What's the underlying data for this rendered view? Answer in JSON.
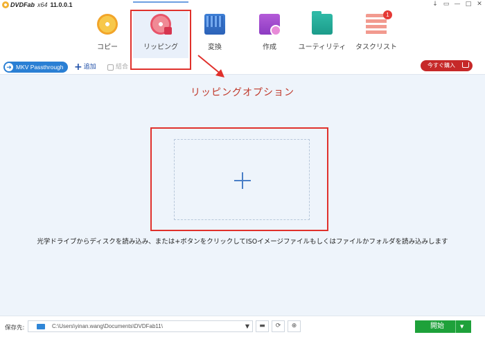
{
  "titlebar": {
    "brand": "DVDFab",
    "arch": "x64",
    "version": "11.0.0.1"
  },
  "window_controls": [
    "↓",
    "▭",
    "—",
    "□",
    "✕"
  ],
  "nav": {
    "items": [
      {
        "label": "コピー",
        "icon": "disc-copy-icon"
      },
      {
        "label": "リッピング",
        "icon": "disc-rip-icon"
      },
      {
        "label": "変換",
        "icon": "video-convert-icon"
      },
      {
        "label": "作成",
        "icon": "video-create-icon"
      },
      {
        "label": "ユーティリティ",
        "icon": "utility-folder-icon"
      },
      {
        "label": "タスクリスト",
        "icon": "task-list-icon"
      }
    ],
    "active_index": 1,
    "task_badge": "1"
  },
  "toolbar": {
    "mkv_label": "MKV Passthrough",
    "add_label": "追加",
    "merge_label": "結合",
    "buy_label": "今すぐ購入"
  },
  "main": {
    "rip_option_title": "リッピングオプション",
    "instruction": "光学ドライブからディスクを読み込み、または+ボタンをクリックしてISOイメージファイルもしくはファイルかフォルダを読み込みします"
  },
  "bottombar": {
    "save_label": "保存先:",
    "path": "C:\\Users\\yinan.wang\\Documents\\DVDFab11\\",
    "start_label": "開始"
  },
  "colors": {
    "accent_blue": "#2a7fd4",
    "highlight_red": "#e0302b",
    "buy_red": "#c62828",
    "start_green": "#1ea13a",
    "main_bg": "#eef4fb"
  }
}
